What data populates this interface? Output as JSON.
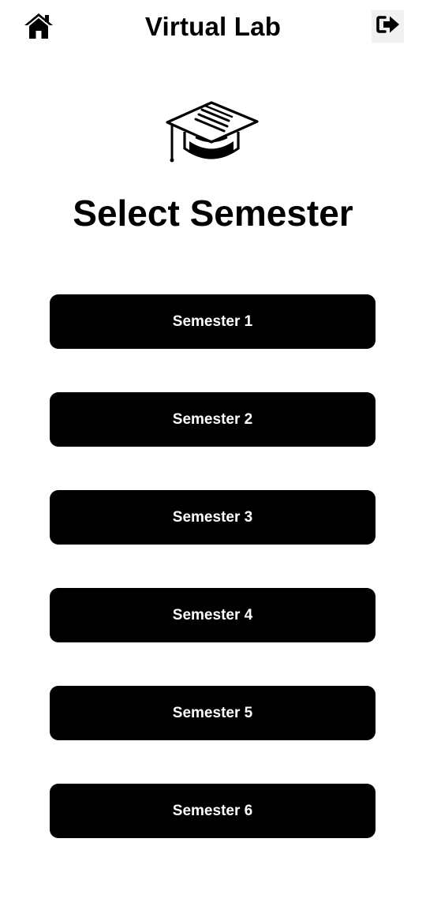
{
  "header": {
    "title": "Virtual Lab",
    "home_icon": "home-icon",
    "logout_icon": "logout-icon"
  },
  "hero": {
    "icon": "graduation-cap-icon",
    "title": "Select Semester"
  },
  "semesters": [
    {
      "label": "Semester 1"
    },
    {
      "label": "Semester 2"
    },
    {
      "label": "Semester 3"
    },
    {
      "label": "Semester 4"
    },
    {
      "label": "Semester 5"
    },
    {
      "label": "Semester 6"
    }
  ],
  "colors": {
    "button_bg": "#000000",
    "button_text": "#ffffff",
    "page_bg": "#ffffff",
    "logout_bg": "#f1f1f1"
  }
}
